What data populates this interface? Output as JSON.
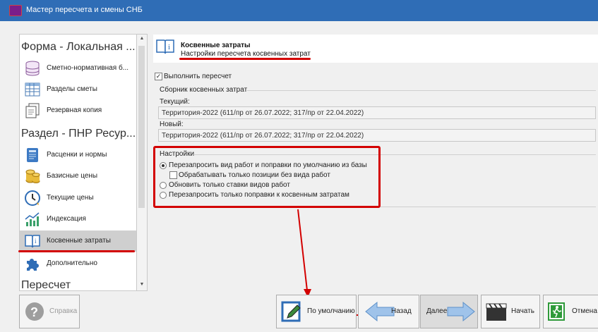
{
  "window": {
    "title": "Мастер пересчета и смены СНБ"
  },
  "sidebar": {
    "groups": [
      {
        "label": "Форма - Локальная ..."
      },
      {
        "label": "Раздел - ПНР Ресур..."
      },
      {
        "label": "Пересчет"
      }
    ],
    "items": [
      {
        "label": "Сметно-нормативная б...",
        "icon": "database-icon"
      },
      {
        "label": "Разделы сметы",
        "icon": "table-icon"
      },
      {
        "label": "Резервная копия",
        "icon": "document-copy-icon"
      },
      {
        "label": "Расценки и нормы",
        "icon": "book-icon"
      },
      {
        "label": "Базисные цены",
        "icon": "coins-icon"
      },
      {
        "label": "Текущие цены",
        "icon": "clock-icon"
      },
      {
        "label": "Индексация",
        "icon": "chart-icon"
      },
      {
        "label": "Косвенные затраты",
        "icon": "info-book-icon"
      },
      {
        "label": "Дополнительно",
        "icon": "puzzle-icon"
      }
    ],
    "selected": "Косвенные затраты"
  },
  "header": {
    "title": "Косвенные затраты",
    "subtitle": "Настройки пересчета косвенных затрат"
  },
  "main": {
    "perform_recalc": {
      "label": "Выполнить пересчет",
      "checked": true
    },
    "collection_group": "Сборник косвенных затрат",
    "current_label": "Текущий:",
    "current_value": "Территория-2022 (611/пр от 26.07.2022; 317/пр от 22.04.2022)",
    "new_label": "Новый:",
    "new_value": "Территория-2022 (611/пр от 26.07.2022; 317/пр от 22.04.2022)",
    "settings_group": "Настройки",
    "options": [
      {
        "label": "Перезапросить вид работ и поправки по умолчанию из базы",
        "selected": true
      },
      {
        "label": "Обрабатывать только позиции без вида работ",
        "checkbox": true,
        "checked": false
      },
      {
        "label": "Обновить только ставки видов работ",
        "selected": false
      },
      {
        "label": "Перезапросить только поправки к косвенным затратам",
        "selected": false
      }
    ]
  },
  "buttons": {
    "help": "Справка",
    "default": "По умолчанию",
    "back": "Назад",
    "next": "Далее",
    "start": "Начать",
    "cancel": "Отмена"
  },
  "colors": {
    "titlebar": "#2f6db6",
    "annotation": "#d30000",
    "selected_item": "#cfcfcf"
  }
}
